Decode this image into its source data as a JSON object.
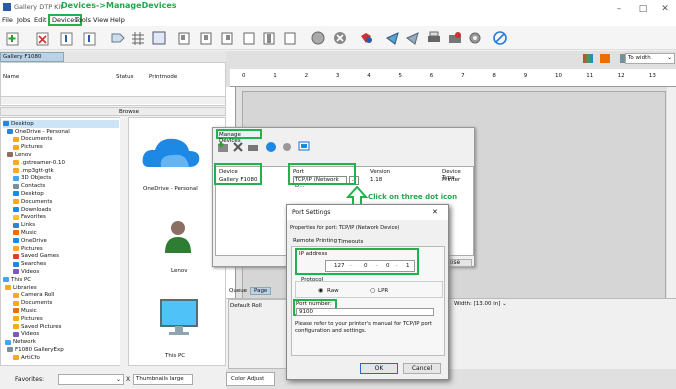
{
  "app": {
    "title": "Gallery DTP Kit",
    "annotation": "Devices->ManageDevices"
  },
  "menu": [
    "File",
    "Jobs",
    "Edit",
    "Devices",
    "Tools",
    "View",
    "Help"
  ],
  "tab": {
    "label": "Gallery F1080"
  },
  "left_columns": {
    "name": "Name",
    "status": "Status",
    "printmode": "Printmode"
  },
  "browse_label": "Browse",
  "tree": [
    "Desktop",
    "OneDrive - Personal",
    "Documents",
    "Pictures",
    "Lenov",
    ".gstreamer-0.10",
    ".mp3gtt-gtk",
    "3D Objects",
    "Contacts",
    "Desktop",
    "Documents",
    "Downloads",
    "Favorites",
    "Links",
    "Music",
    "OneDrive",
    "Pictures",
    "Saved Games",
    "Searches",
    "Videos",
    "This PC",
    "Libraries",
    "Camera Roll",
    "Documents",
    "Music",
    "Pictures",
    "Saved Pictures",
    "Videos",
    "Network",
    "F1080 GalleryExp",
    "ArtiCfo"
  ],
  "thumbs": {
    "onedrive": "OneDrive - Personal",
    "lenov": "Lenov",
    "thispc": "This PC"
  },
  "bottom": {
    "favorites": "Favorites:",
    "thumb_select": "Thumbnails large",
    "color_adjust": "Color Adjust"
  },
  "zoom": {
    "value": "To width"
  },
  "ruler": [
    "0",
    "1",
    "2",
    "3",
    "4",
    "5",
    "6",
    "7",
    "8",
    "9",
    "10",
    "11",
    "12",
    "13"
  ],
  "lower_tabs": {
    "queue": "Queue",
    "page": "Page"
  },
  "roll": {
    "label": "Default Roll"
  },
  "width_select": "Width: [13.00 in]",
  "manage": {
    "title": "Manage Devices",
    "columns": {
      "device": "Device",
      "port": "Port",
      "version": "Version",
      "type": "Device Type"
    },
    "row": {
      "device": "Gallery F1080",
      "port": "TCP/IP (Network D...",
      "port_btn": "...",
      "version": "1.18",
      "type": "Printer"
    },
    "close": "Close"
  },
  "annotation": "Click on three dot icon",
  "port": {
    "title": "Port Settings",
    "close": "✕",
    "properties": "Properties for port: TCP/IP (Network Device)",
    "tabs": [
      "Remote Printing",
      "Timeouts"
    ],
    "ip_label": "IP address",
    "ip": [
      "127",
      "0",
      "0",
      "1"
    ],
    "protocol_label": "Protocol",
    "raw": "Raw",
    "lpr": "LPR",
    "port_label": "Port number:",
    "port_value": "9100",
    "note": "Please refer to your printer's manual for TCP/IP port configuration and settings.",
    "ok": "OK",
    "cancel": "Cancel"
  }
}
